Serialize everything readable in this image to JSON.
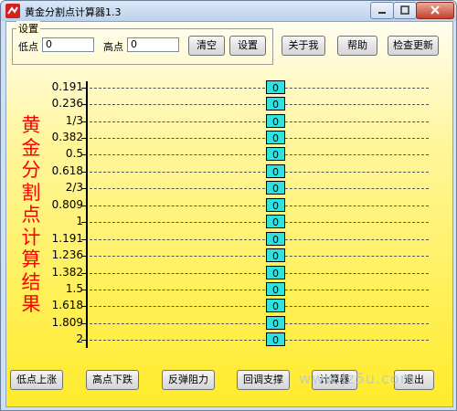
{
  "window": {
    "title": "黄金分割点计算器1.3"
  },
  "settings": {
    "group_label": "设置",
    "low_label": "低点",
    "low_value": "0",
    "high_label": "高点",
    "high_value": "0",
    "clear_label": "清空",
    "set_label": "设置"
  },
  "top_buttons": {
    "about": "关于我",
    "help": "帮助",
    "update": "检查更新"
  },
  "vertical_title": [
    "黄",
    "金",
    "分",
    "割",
    "点",
    "计",
    "算",
    "结",
    "果"
  ],
  "ratios": [
    "0.191",
    "0.236",
    "1/3",
    "0.382",
    "0.5",
    "0.618",
    "2/3",
    "0.809",
    "1",
    "1.191",
    "1.236",
    "1.382",
    "1.5",
    "1.618",
    "1.809",
    "2"
  ],
  "results": [
    "0",
    "0",
    "0",
    "0",
    "0",
    "0",
    "0",
    "0",
    "0",
    "0",
    "0",
    "0",
    "0",
    "0",
    "0",
    "0"
  ],
  "bottom_buttons": {
    "low_rise": "低点上涨",
    "high_fall": "高点下跌",
    "rebound": "反弹阻力",
    "pullback": "回调支撑",
    "calculator": "计算器",
    "exit": "退出"
  },
  "watermark": "www.jz5u.com"
}
